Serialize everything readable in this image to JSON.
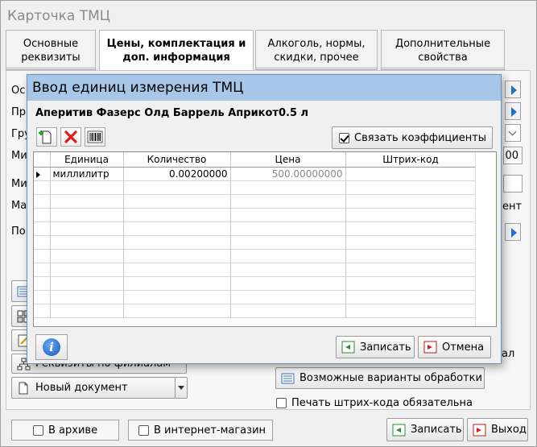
{
  "main": {
    "title": "Карточка ТМЦ",
    "tabs": [
      {
        "label": "Основные реквизиты"
      },
      {
        "label": "Цены, комплектация и доп. информация"
      },
      {
        "label": "Алкоголь, нормы, скидки, прочее"
      },
      {
        "label": "Дополнительные свойства"
      }
    ],
    "field_fragments": [
      "Ос",
      "Пр",
      "Гру",
      "Ми",
      "Ми",
      "Ма",
      "По"
    ],
    "right_fragments": {
      "value_00": "00",
      "text_ent": "ент",
      "text_al": "ал"
    },
    "branch_details_button": "Реквизиты по филиалам",
    "new_document_button": "Новый документ",
    "processing_variants_button": "Возможные варианты обработки",
    "barcode_required": "Печать штрих-кода обязательна",
    "archive_checkbox": "В архиве",
    "webshop_checkbox": "В интернет-магазин",
    "save_button": "Записать",
    "exit_button": "Выход"
  },
  "dialog": {
    "title": "Ввод единиц измерения ТМЦ",
    "product_name": "Аперитив Фазерс Олд Баррель Априкот0.5 л",
    "link_coefficients": {
      "label": "Связать коэффициенты",
      "checked": true
    },
    "columns": [
      "Единица",
      "Количество",
      "Цена",
      "Штрих-код"
    ],
    "rows": [
      {
        "unit": "миллилитр",
        "quantity": "0.00200000",
        "price": "500.00000000",
        "barcode": ""
      }
    ],
    "save_button": "Записать",
    "cancel_button": "Отмена"
  },
  "colors": {
    "dialog_titlebar": "#a7c6e8",
    "arrow_blue": "#1e6fd0",
    "delete_red": "#d81e1e"
  }
}
